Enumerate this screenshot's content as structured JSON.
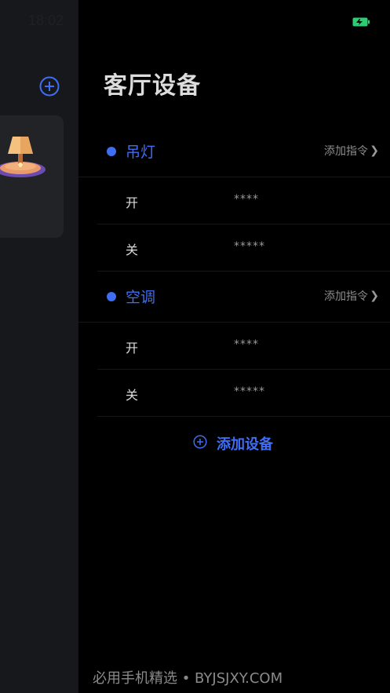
{
  "status": {
    "time": "18:02"
  },
  "drawer": {
    "title": "客厅设备",
    "groups": [
      {
        "name": "吊灯",
        "action": "添加指令",
        "commands": [
          {
            "label": "开",
            "value": "****"
          },
          {
            "label": "关",
            "value": "*****"
          }
        ]
      },
      {
        "name": "空调",
        "action": "添加指令",
        "commands": [
          {
            "label": "开",
            "value": "****"
          },
          {
            "label": "关",
            "value": "*****"
          }
        ]
      }
    ],
    "add_device_label": "添加设备"
  },
  "watermark": "必用手机精选 • BYJSJXY.COM",
  "colors": {
    "accent": "#3f6df3",
    "battery": "#2ecc71"
  }
}
